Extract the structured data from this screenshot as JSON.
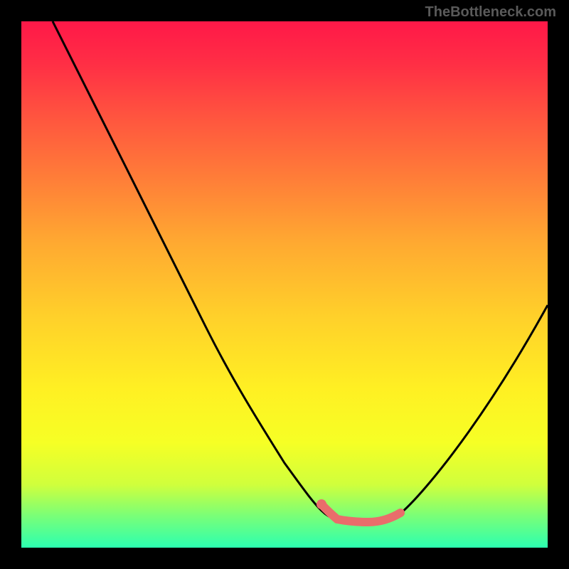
{
  "watermark": "TheBottleneck.com",
  "chart_data": {
    "type": "line",
    "title": "",
    "xlabel": "",
    "ylabel": "",
    "xlim": [
      0,
      100
    ],
    "ylim": [
      0,
      100
    ],
    "series": [
      {
        "name": "bottleneck-curve",
        "x": [
          6,
          10,
          15,
          20,
          25,
          30,
          35,
          40,
          45,
          50,
          53,
          56,
          58,
          60,
          62,
          64,
          66,
          68,
          70,
          72,
          75,
          80,
          85,
          90,
          95,
          100
        ],
        "y": [
          100,
          92,
          82,
          72,
          62,
          52,
          42,
          33,
          24,
          16,
          12,
          9,
          7,
          6,
          5.5,
          5,
          5,
          5,
          5.5,
          6.5,
          9,
          15,
          22,
          30,
          38,
          46
        ],
        "color": "#000000"
      },
      {
        "name": "optimal-range-highlight",
        "x": [
          57,
          58,
          60,
          62,
          64,
          66,
          68,
          70,
          71,
          72
        ],
        "y": [
          8.2,
          7.2,
          6,
          5.5,
          5,
          5,
          5,
          5.5,
          5.7,
          6.5
        ],
        "color": "#e96d6b"
      }
    ],
    "highlight_points": [
      {
        "x": 57,
        "y": 8.2,
        "color": "#e96d6b"
      }
    ],
    "gradient_stops": [
      {
        "pos": 0,
        "color": "#ff1848"
      },
      {
        "pos": 50,
        "color": "#ffd02a"
      },
      {
        "pos": 80,
        "color": "#f6ff25"
      },
      {
        "pos": 100,
        "color": "#2cffb0"
      }
    ]
  }
}
